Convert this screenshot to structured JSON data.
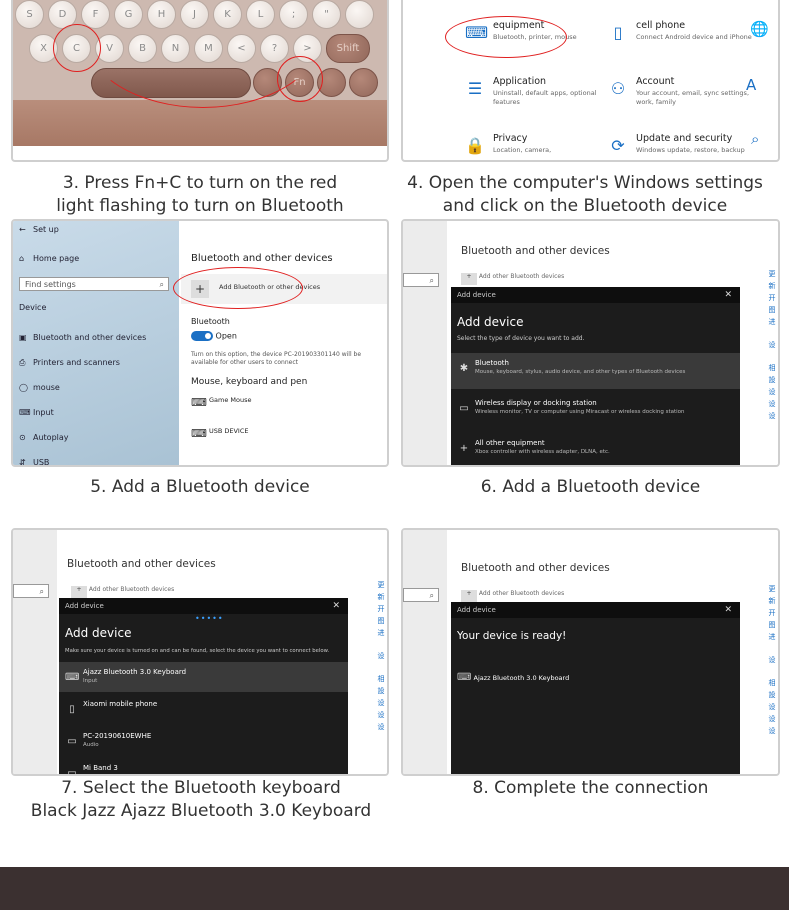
{
  "colors": {
    "accent": "#1a6fc4",
    "highlight_ring": "#e02020",
    "footer": "#3b3030"
  },
  "steps": {
    "s3": {
      "caption_l1": "3. Press Fn+C to turn on the red",
      "caption_l2": "light flashing to turn on Bluetooth",
      "keys_row1": [
        "S",
        "D",
        "F",
        "G",
        "H",
        "J",
        "K",
        "L",
        ";",
        "\"",
        ""
      ],
      "keys_row2": [
        "X",
        "C",
        "V",
        "B",
        "N",
        "M",
        "<",
        "?",
        ">",
        "Shift"
      ],
      "fn_key": "Fn"
    },
    "s4": {
      "caption_l1": "4. Open the computer's Windows settings",
      "caption_l2": "and click on the Bluetooth device",
      "items": [
        {
          "icon": "devices-icon",
          "title": "equipment",
          "sub": "Bluetooth, printer, mouse"
        },
        {
          "icon": "phone-icon",
          "title": "cell phone",
          "sub": "Connect Android device and iPhone"
        },
        {
          "icon": "apps-icon",
          "title": "Application",
          "sub": "Uninstall, default apps, optional features"
        },
        {
          "icon": "account-icon",
          "title": "Account",
          "sub": "Your account, email, sync settings, work, family"
        },
        {
          "icon": "lock-icon",
          "title": "Privacy",
          "sub": "Location, camera,"
        },
        {
          "icon": "sync-icon",
          "title": "Update and security",
          "sub": "Windows update, restore, backup"
        }
      ]
    },
    "s5": {
      "caption": "5. Add a Bluetooth device",
      "back": "Set up",
      "home": "Home page",
      "search_placeholder": "Find settings",
      "device_header": "Device",
      "nav": [
        "Bluetooth and other devices",
        "Printers and scanners",
        "mouse",
        "Input",
        "Autoplay",
        "USB"
      ],
      "title": "Bluetooth and other devices",
      "add_label": "Add Bluetooth or other devices",
      "bt_label": "Bluetooth",
      "toggle_label": "Open",
      "desc": "Turn on this option, the device PC-201903301140 will be available for other users to connect",
      "section": "Mouse, keyboard and pen",
      "dev1": "Game Mouse",
      "dev2": "USB DEVICE"
    },
    "s6": {
      "caption": "6. Add a Bluetooth device",
      "bg_title": "Bluetooth and other devices",
      "bg_add": "Add other Bluetooth devices",
      "bar": "Add device",
      "heading": "Add device",
      "sub": "Select the type of device you want to add.",
      "options": [
        {
          "title": "Bluetooth",
          "sub": "Mouse, keyboard, stylus, audio device, and other types of Bluetooth devices"
        },
        {
          "title": "Wireless display or docking station",
          "sub": "Wireless monitor, TV or computer using Miracast or wireless docking station"
        },
        {
          "title": "All other equipment",
          "sub": "Xbox controller with wireless adapter, DLNA, etc."
        }
      ],
      "right_col": [
        "更",
        "新",
        "开",
        "图",
        "进",
        "设",
        "相",
        "設",
        "设",
        "设",
        "设"
      ]
    },
    "s7": {
      "caption_l1": "7. Select the Bluetooth keyboard",
      "caption_l2": "Black Jazz Ajazz Bluetooth 3.0 Keyboard",
      "bg_title": "Bluetooth and other devices",
      "bg_add": "Add other Bluetooth devices",
      "bar": "Add device",
      "heading": "Add device",
      "sub": "Make sure your device is turned on and can be found, select the device you want to connect below.",
      "devices": [
        {
          "title": "Ajazz Bluetooth 3.0 Keyboard",
          "sub": "Input"
        },
        {
          "title": "Xiaomi mobile phone",
          "sub": ""
        },
        {
          "title": "PC-20190610EWHE",
          "sub": "Audio"
        },
        {
          "title": "Mi Band 3",
          "sub": ""
        }
      ]
    },
    "s8": {
      "caption": "8. Complete the connection",
      "bg_title": "Bluetooth and other devices",
      "bg_add": "Add other Bluetooth devices",
      "bar": "Add device",
      "heading": "Your device is ready!",
      "device": "Ajazz Bluetooth 3.0 Keyboard"
    }
  }
}
